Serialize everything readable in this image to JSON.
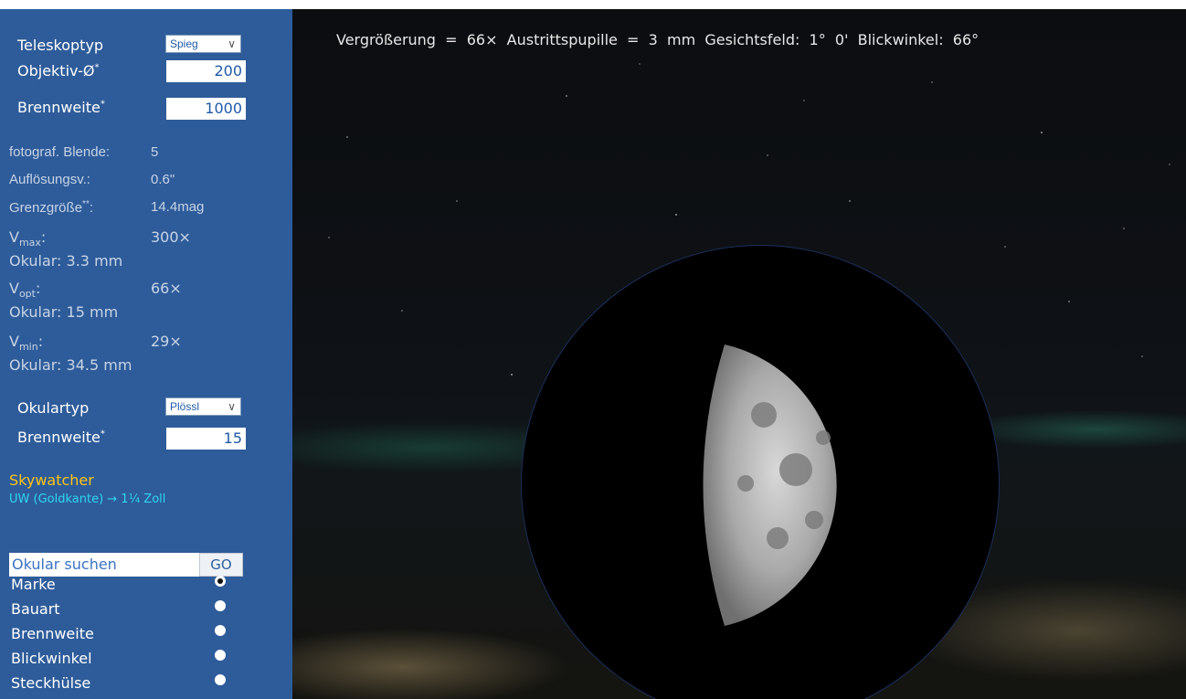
{
  "telescope": {
    "type_label": "Teleskoptyp",
    "type_value": "Spieg",
    "aperture_label": "Objektiv-Ø",
    "aperture_value": "200",
    "focal_label": "Brennweite",
    "focal_value": "1000",
    "asterisk": "*"
  },
  "results": {
    "blende_label": "fotograf. Blende:",
    "blende_value": "5",
    "aufl_label": "Auflösungsv.:",
    "aufl_value": "0.6\"",
    "grenz_label": "Grenzgröße",
    "grenz_sup": "**",
    "grenz_colon": ":",
    "grenz_value": "14.4mag",
    "vmax_v": "V",
    "vmax_sub": "max",
    "vmax_value": "300×",
    "vmax_okular": "Okular:  3.3  mm",
    "vopt_v": "V",
    "vopt_sub": "opt",
    "vopt_value": "66×",
    "vopt_okular": "Okular:  15  mm",
    "vmin_v": "V",
    "vmin_sub": "min",
    "vmin_value": "29×",
    "vmin_okular": "Okular:  34.5  mm",
    "colon": ":"
  },
  "eyepiece": {
    "type_label": "Okulartyp",
    "type_value": "Plössl",
    "focal_label": "Brennweite",
    "focal_value": "15",
    "asterisk": "*",
    "brand": "Skywatcher",
    "model": "UW  (Goldkante)  →  1¼  Zoll"
  },
  "search": {
    "placeholder": "Okular suchen",
    "go": "GO",
    "sort_options": [
      {
        "label": "Marke",
        "selected": true
      },
      {
        "label": "Bauart",
        "selected": false
      },
      {
        "label": "Brennweite",
        "selected": false
      },
      {
        "label": "Blickwinkel",
        "selected": false
      },
      {
        "label": "Steckhülse",
        "selected": false
      }
    ]
  },
  "view": {
    "readout": "Vergrößerung  =  66×  Austrittspupille  =  3  mm  Gesichtsfeld:  1°  0'  Blickwinkel:  66°"
  },
  "colors": {
    "panel": "#2e5c9a",
    "accent_yellow": "#ffc414",
    "accent_cyan": "#2fd6f0"
  }
}
